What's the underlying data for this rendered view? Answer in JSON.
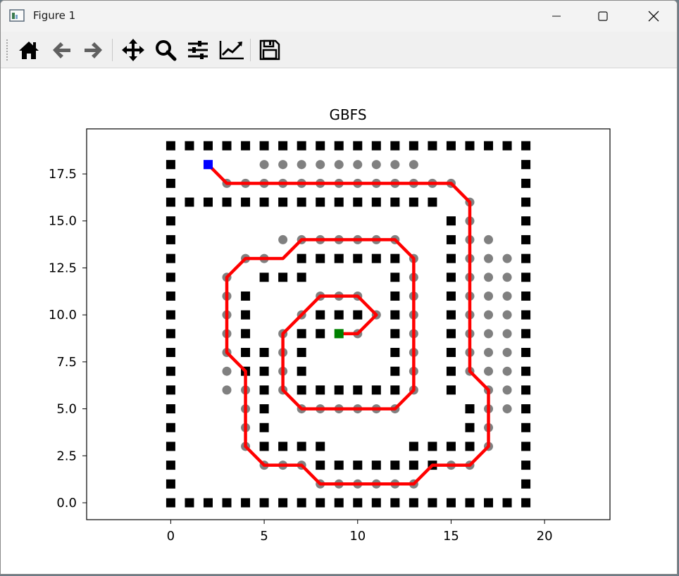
{
  "window": {
    "title": "Figure 1",
    "controls": [
      "minimize",
      "maximize",
      "close"
    ]
  },
  "toolbar": {
    "buttons": [
      {
        "name": "home-icon",
        "tip": "Home"
      },
      {
        "name": "back-icon",
        "tip": "Back"
      },
      {
        "name": "forward-icon",
        "tip": "Forward"
      },
      {
        "name": "pan-icon",
        "tip": "Pan"
      },
      {
        "name": "zoom-icon",
        "tip": "Zoom"
      },
      {
        "name": "subplots-icon",
        "tip": "Subplots"
      },
      {
        "name": "edit-axes-icon",
        "tip": "Customize"
      },
      {
        "name": "save-icon",
        "tip": "Save"
      }
    ]
  },
  "chart_data": {
    "type": "scatter",
    "title": "GBFS",
    "xlim": [
      -4.5,
      23.5
    ],
    "ylim": [
      -0.9,
      19.9
    ],
    "xticks": [
      0,
      5,
      10,
      15,
      20
    ],
    "xtick_labels": [
      "0",
      "5",
      "10",
      "15",
      "20"
    ],
    "yticks": [
      0.0,
      2.5,
      5.0,
      7.5,
      10.0,
      12.5,
      15.0,
      17.5
    ],
    "ytick_labels": [
      "0.0",
      "2.5",
      "5.0",
      "7.5",
      "10.0",
      "12.5",
      "15.0",
      "17.5"
    ],
    "grid": false,
    "colors": {
      "obstacle": "#000000",
      "visited": "#808080",
      "path": "#ff0000",
      "start": "#0000ff",
      "goal": "#008000"
    },
    "obstacles": [
      [
        0,
        0
      ],
      [
        1,
        0
      ],
      [
        2,
        0
      ],
      [
        3,
        0
      ],
      [
        4,
        0
      ],
      [
        5,
        0
      ],
      [
        6,
        0
      ],
      [
        7,
        0
      ],
      [
        8,
        0
      ],
      [
        9,
        0
      ],
      [
        10,
        0
      ],
      [
        11,
        0
      ],
      [
        12,
        0
      ],
      [
        13,
        0
      ],
      [
        14,
        0
      ],
      [
        15,
        0
      ],
      [
        16,
        0
      ],
      [
        17,
        0
      ],
      [
        18,
        0
      ],
      [
        19,
        0
      ],
      [
        0,
        19
      ],
      [
        1,
        19
      ],
      [
        2,
        19
      ],
      [
        3,
        19
      ],
      [
        4,
        19
      ],
      [
        5,
        19
      ],
      [
        6,
        19
      ],
      [
        7,
        19
      ],
      [
        8,
        19
      ],
      [
        9,
        19
      ],
      [
        10,
        19
      ],
      [
        11,
        19
      ],
      [
        12,
        19
      ],
      [
        13,
        19
      ],
      [
        14,
        19
      ],
      [
        15,
        19
      ],
      [
        16,
        19
      ],
      [
        17,
        19
      ],
      [
        18,
        19
      ],
      [
        19,
        19
      ],
      [
        0,
        1
      ],
      [
        0,
        2
      ],
      [
        0,
        3
      ],
      [
        0,
        4
      ],
      [
        0,
        5
      ],
      [
        0,
        6
      ],
      [
        0,
        7
      ],
      [
        0,
        8
      ],
      [
        0,
        9
      ],
      [
        0,
        10
      ],
      [
        0,
        11
      ],
      [
        0,
        12
      ],
      [
        0,
        13
      ],
      [
        0,
        14
      ],
      [
        0,
        15
      ],
      [
        0,
        16
      ],
      [
        0,
        17
      ],
      [
        0,
        18
      ],
      [
        19,
        1
      ],
      [
        19,
        2
      ],
      [
        19,
        3
      ],
      [
        19,
        4
      ],
      [
        19,
        5
      ],
      [
        19,
        6
      ],
      [
        19,
        7
      ],
      [
        19,
        8
      ],
      [
        19,
        9
      ],
      [
        19,
        10
      ],
      [
        19,
        11
      ],
      [
        19,
        12
      ],
      [
        19,
        13
      ],
      [
        19,
        14
      ],
      [
        19,
        15
      ],
      [
        19,
        16
      ],
      [
        19,
        17
      ],
      [
        19,
        18
      ],
      [
        1,
        16
      ],
      [
        2,
        16
      ],
      [
        3,
        16
      ],
      [
        4,
        16
      ],
      [
        5,
        16
      ],
      [
        6,
        16
      ],
      [
        7,
        16
      ],
      [
        8,
        16
      ],
      [
        9,
        16
      ],
      [
        10,
        16
      ],
      [
        11,
        16
      ],
      [
        12,
        16
      ],
      [
        13,
        16
      ],
      [
        14,
        16
      ],
      [
        15,
        15
      ],
      [
        15,
        14
      ],
      [
        15,
        13
      ],
      [
        15,
        12
      ],
      [
        15,
        11
      ],
      [
        15,
        10
      ],
      [
        15,
        9
      ],
      [
        15,
        8
      ],
      [
        15,
        7
      ],
      [
        15,
        6
      ],
      [
        16,
        5
      ],
      [
        16,
        4
      ],
      [
        16,
        3
      ],
      [
        15,
        3
      ],
      [
        14,
        3
      ],
      [
        13,
        3
      ],
      [
        8,
        2
      ],
      [
        9,
        2
      ],
      [
        10,
        2
      ],
      [
        11,
        2
      ],
      [
        12,
        2
      ],
      [
        13,
        2
      ],
      [
        14,
        2
      ],
      [
        5,
        3
      ],
      [
        6,
        3
      ],
      [
        7,
        3
      ],
      [
        8,
        3
      ],
      [
        5,
        4
      ],
      [
        5,
        5
      ],
      [
        5,
        6
      ],
      [
        5,
        7
      ],
      [
        5,
        8
      ],
      [
        4,
        7
      ],
      [
        4,
        8
      ],
      [
        4,
        9
      ],
      [
        4,
        10
      ],
      [
        4,
        11
      ],
      [
        5,
        12
      ],
      [
        6,
        12
      ],
      [
        7,
        12
      ],
      [
        7,
        13
      ],
      [
        8,
        13
      ],
      [
        9,
        13
      ],
      [
        10,
        13
      ],
      [
        11,
        13
      ],
      [
        12,
        13
      ],
      [
        12,
        12
      ],
      [
        12,
        11
      ],
      [
        12,
        10
      ],
      [
        12,
        9
      ],
      [
        12,
        8
      ],
      [
        12,
        7
      ],
      [
        12,
        6
      ],
      [
        7,
        6
      ],
      [
        8,
        6
      ],
      [
        9,
        6
      ],
      [
        10,
        6
      ],
      [
        11,
        6
      ],
      [
        7,
        7
      ],
      [
        7,
        8
      ],
      [
        7,
        9
      ],
      [
        8,
        10
      ],
      [
        9,
        10
      ],
      [
        10,
        10
      ],
      [
        8,
        9
      ]
    ],
    "visited": [
      [
        5,
        18
      ],
      [
        6,
        18
      ],
      [
        7,
        18
      ],
      [
        8,
        18
      ],
      [
        9,
        18
      ],
      [
        10,
        18
      ],
      [
        11,
        18
      ],
      [
        12,
        18
      ],
      [
        13,
        18
      ],
      [
        3,
        17
      ],
      [
        4,
        17
      ],
      [
        5,
        17
      ],
      [
        6,
        17
      ],
      [
        7,
        17
      ],
      [
        8,
        17
      ],
      [
        9,
        17
      ],
      [
        10,
        17
      ],
      [
        11,
        17
      ],
      [
        12,
        17
      ],
      [
        13,
        17
      ],
      [
        14,
        17
      ],
      [
        15,
        17
      ],
      [
        16,
        16
      ],
      [
        16,
        15
      ],
      [
        16,
        14
      ],
      [
        16,
        13
      ],
      [
        16,
        12
      ],
      [
        16,
        11
      ],
      [
        16,
        10
      ],
      [
        16,
        9
      ],
      [
        16,
        8
      ],
      [
        16,
        7
      ],
      [
        17,
        14
      ],
      [
        17,
        13
      ],
      [
        17,
        12
      ],
      [
        17,
        11
      ],
      [
        17,
        10
      ],
      [
        17,
        9
      ],
      [
        17,
        8
      ],
      [
        17,
        7
      ],
      [
        17,
        6
      ],
      [
        18,
        13
      ],
      [
        18,
        12
      ],
      [
        18,
        11
      ],
      [
        18,
        10
      ],
      [
        18,
        9
      ],
      [
        18,
        8
      ],
      [
        18,
        7
      ],
      [
        18,
        6
      ],
      [
        18,
        5
      ],
      [
        17,
        5
      ],
      [
        17,
        4
      ],
      [
        17,
        3
      ],
      [
        15,
        2
      ],
      [
        16,
        2
      ],
      [
        8,
        1
      ],
      [
        9,
        1
      ],
      [
        10,
        1
      ],
      [
        11,
        1
      ],
      [
        12,
        1
      ],
      [
        13,
        1
      ],
      [
        5,
        2
      ],
      [
        6,
        2
      ],
      [
        7,
        2
      ],
      [
        4,
        3
      ],
      [
        4,
        4
      ],
      [
        4,
        5
      ],
      [
        4,
        6
      ],
      [
        3,
        6
      ],
      [
        3,
        7
      ],
      [
        3,
        8
      ],
      [
        3,
        9
      ],
      [
        3,
        10
      ],
      [
        3,
        11
      ],
      [
        3,
        12
      ],
      [
        4,
        13
      ],
      [
        5,
        13
      ],
      [
        6,
        14
      ],
      [
        7,
        14
      ],
      [
        8,
        14
      ],
      [
        9,
        14
      ],
      [
        10,
        14
      ],
      [
        11,
        14
      ],
      [
        12,
        14
      ],
      [
        13,
        13
      ],
      [
        13,
        12
      ],
      [
        13,
        11
      ],
      [
        13,
        10
      ],
      [
        13,
        9
      ],
      [
        13,
        8
      ],
      [
        13,
        7
      ],
      [
        13,
        6
      ],
      [
        12,
        5
      ],
      [
        11,
        5
      ],
      [
        10,
        5
      ],
      [
        9,
        5
      ],
      [
        8,
        5
      ],
      [
        7,
        5
      ],
      [
        6,
        6
      ],
      [
        6,
        7
      ],
      [
        6,
        8
      ],
      [
        6,
        9
      ],
      [
        7,
        10
      ],
      [
        8,
        11
      ],
      [
        9,
        11
      ],
      [
        10,
        11
      ],
      [
        11,
        10
      ],
      [
        10,
        9
      ]
    ],
    "path": {
      "x": [
        2,
        3,
        15,
        16,
        16,
        17,
        17,
        16,
        14,
        13,
        8,
        7,
        5,
        4,
        4,
        3,
        3,
        4,
        6,
        7,
        12,
        13,
        13,
        12,
        7,
        6,
        6,
        8,
        10,
        11,
        10,
        9
      ],
      "y": [
        18,
        17,
        17,
        16,
        7,
        6,
        3,
        2,
        2,
        1,
        1,
        2,
        2,
        3,
        7,
        8,
        12,
        13,
        13,
        14,
        14,
        13,
        6,
        5,
        5,
        6,
        9,
        11,
        11,
        10,
        9,
        9
      ]
    },
    "start": [
      2,
      18
    ],
    "goal": [
      9,
      9
    ]
  }
}
